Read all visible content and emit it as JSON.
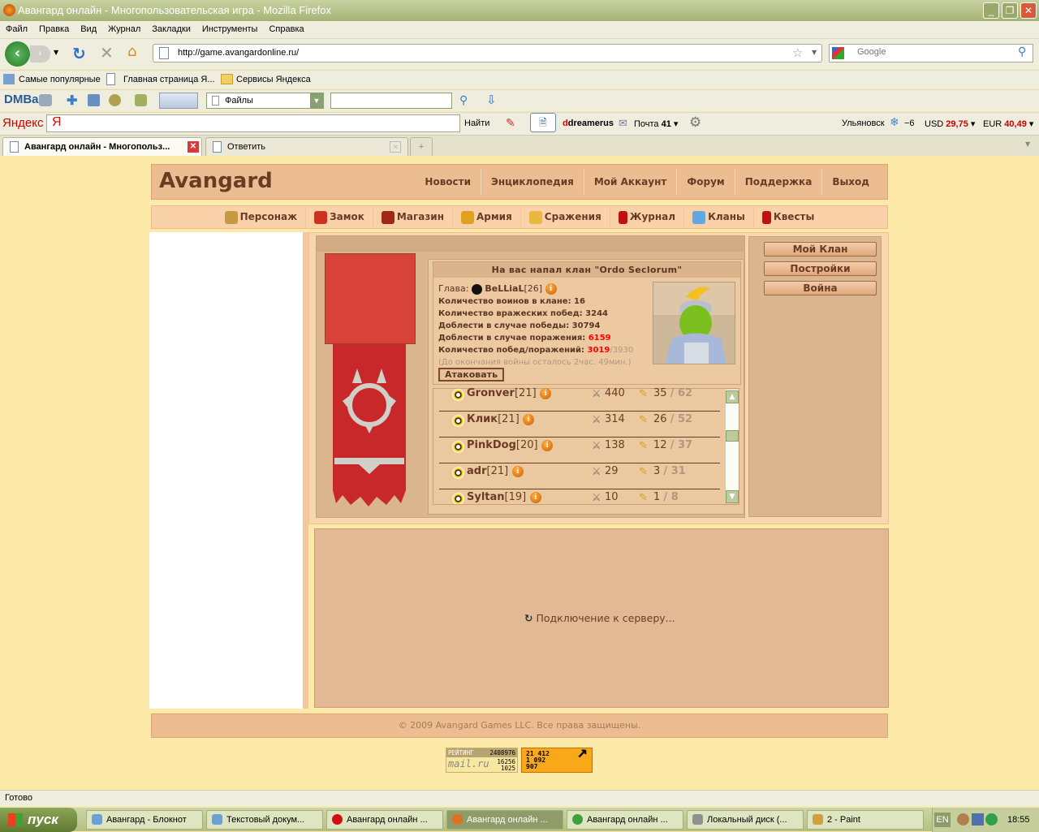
{
  "window": {
    "title": "Авангард онлайн - Многопользовательская игра - Mozilla Firefox"
  },
  "menu": [
    "Файл",
    "Правка",
    "Вид",
    "Журнал",
    "Закладки",
    "Инструменты",
    "Справка"
  ],
  "nav": {
    "url": "http://game.avangardonline.ru/",
    "search_placeholder": "Google"
  },
  "bookmarks": [
    "Самые популярные",
    "Главная страница Я...",
    "Сервисы Яндекса"
  ],
  "dmbar": {
    "logo": "DMBar",
    "files_select": "Файлы"
  },
  "yandex": {
    "logo": "Яндекс",
    "search_btn": "Найти",
    "user": "dreamerus",
    "mail_label": "Почта",
    "mail_count": "41",
    "city": "Ульяновск",
    "temp": "−6",
    "usd_label": "USD",
    "usd": "29,75",
    "eur_label": "EUR",
    "eur": "40,49"
  },
  "tabs": [
    {
      "label": "Авангард онлайн - Многопольз...",
      "active": true
    },
    {
      "label": "Ответить",
      "active": false
    }
  ],
  "site": {
    "logo": "Avangard",
    "topnav": [
      "Новости",
      "Энциклопедия",
      "Мой Аккаунт",
      "Форум",
      "Поддержка",
      "Выход"
    ],
    "mainnav": [
      {
        "label": "Персонаж",
        "icon": "character-icon",
        "color": "#c89a40"
      },
      {
        "label": "Замок",
        "icon": "castle-icon",
        "color": "#d03020"
      },
      {
        "label": "Магазин",
        "icon": "shop-icon",
        "color": "#a02818"
      },
      {
        "label": "Армия",
        "icon": "army-icon",
        "color": "#e0a020"
      },
      {
        "label": "Сражения",
        "icon": "battles-icon",
        "color": "#e8b840"
      },
      {
        "label": "Журнал",
        "icon": "journal-icon",
        "color": "#c01010"
      },
      {
        "label": "Кланы",
        "icon": "clans-icon",
        "color": "#60a8e0"
      },
      {
        "label": "Квесты",
        "icon": "quests-icon",
        "color": "#c01010"
      }
    ],
    "war": {
      "title": "На вас напал клан \"Ordo Seclorum\"",
      "leader_label": "Глава:",
      "leader": "BeLLiaL",
      "leader_level": "[26]",
      "warriors": "Количество воинов в клане: 16",
      "enemy_wins": "Количество вражеских побед: 3244",
      "valor_win": "Доблести в случае победы: 30794",
      "valor_loss_label": "Доблести в случае поражения: ",
      "valor_loss": "6159",
      "wl_label": "Количество побед/поражений: ",
      "wins": "3019",
      "losses": "/3930",
      "time_left": "(До окончания войны осталось 2час. 49мин.)",
      "attack_btn": "Атаковать"
    },
    "members": [
      {
        "name": "Gronver",
        "level": "[21]",
        "battles": "440",
        "a": "35",
        "b": "/ 62"
      },
      {
        "name": "Клик",
        "level": "[21]",
        "battles": "314",
        "a": "26",
        "b": "/ 52"
      },
      {
        "name": "PinkDog",
        "level": "[20]",
        "battles": "138",
        "a": "12",
        "b": "/ 37"
      },
      {
        "name": "adr",
        "level": "[21]",
        "battles": "29",
        "a": "3",
        "b": "/ 31"
      },
      {
        "name": "Syltan",
        "level": "[19]",
        "battles": "10",
        "a": "1",
        "b": "/ 8"
      }
    ],
    "scroll_position": 0.35,
    "side_buttons": [
      "Мой Клан",
      "Постройки",
      "Война"
    ],
    "loading": "Подключение к серверу...",
    "footer": "© 2009 Avangard Games LLC. Все права защищены.",
    "counter_mail": {
      "label": "РЕЙТИНГ",
      "logo": "mail.ru",
      "v1": "2408976",
      "v2": "16256",
      "v3": "1025"
    },
    "counter_li": {
      "v1": "21 412",
      "v2": "1 092",
      "v3": "907"
    }
  },
  "status": "Готово",
  "taskbar": {
    "start": "пуск",
    "items": [
      {
        "label": "Авангард - Блокнот",
        "color": "#6aa0d8"
      },
      {
        "label": "Текстовый докум...",
        "color": "#6aa0d8"
      },
      {
        "label": "Авангард онлайн ...",
        "color": "#d01010"
      },
      {
        "label": "Авангард онлайн ...",
        "color": "#e07020",
        "active": true
      },
      {
        "label": "Авангард онлайн ...",
        "color": "#40a040"
      },
      {
        "label": "Локальный диск (...",
        "color": "#909090"
      },
      {
        "label": "2 - Paint",
        "color": "#d0a040"
      }
    ],
    "lang": "EN",
    "time": "18:55"
  }
}
